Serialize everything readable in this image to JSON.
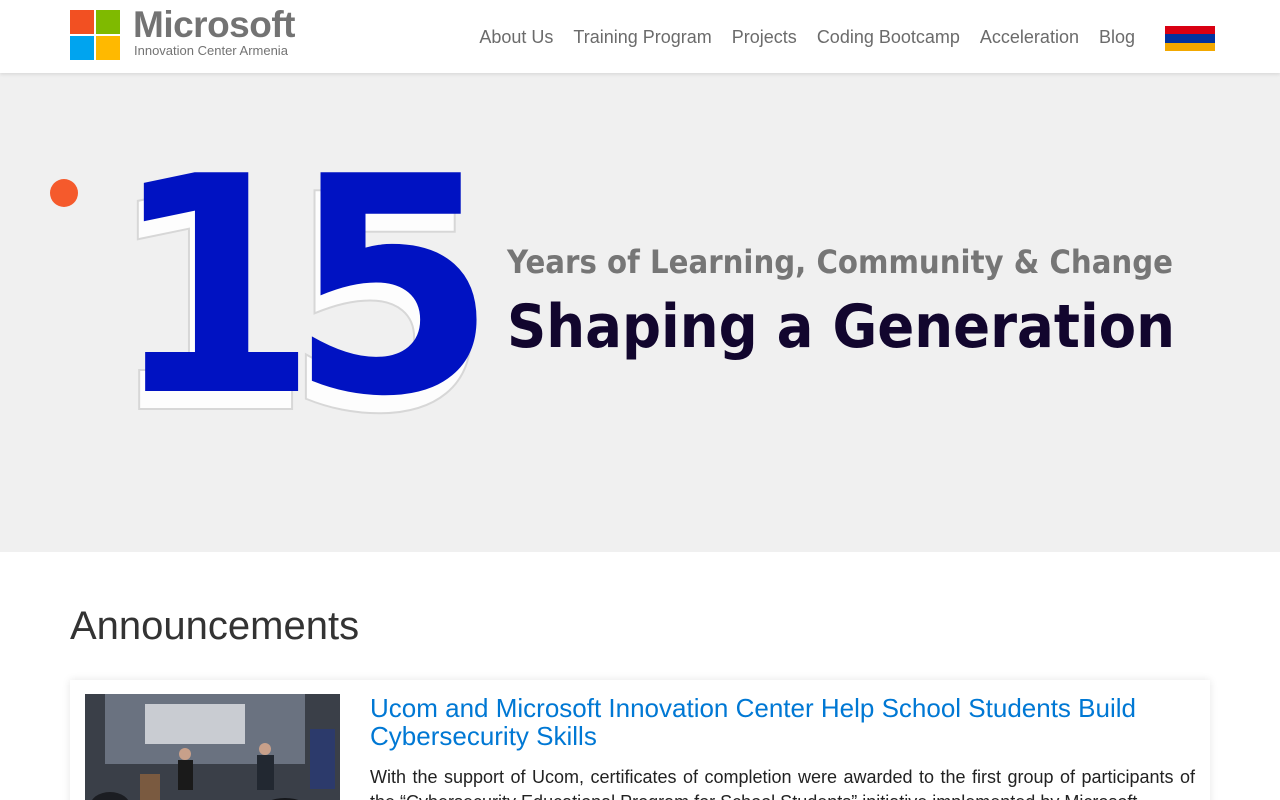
{
  "header": {
    "logo": {
      "brand": "Microsoft",
      "subtitle": "Innovation Center Armenia"
    },
    "nav": [
      {
        "label": "About Us"
      },
      {
        "label": "Training Program"
      },
      {
        "label": "Projects"
      },
      {
        "label": "Coding Bootcamp"
      },
      {
        "label": "Acceleration"
      },
      {
        "label": "Blog"
      }
    ],
    "language_flag": "armenian-flag-icon"
  },
  "hero": {
    "number": "15",
    "tagline": "Years of Learning, Community & Change",
    "headline": "Shaping a Generation",
    "colors": {
      "number": "#0012c2",
      "tagline": "#767676",
      "headline": "#12062e",
      "dot": "#f55a2c",
      "background": "#f0f0f0"
    }
  },
  "announcements": {
    "title": "Announcements",
    "items": [
      {
        "title": "Ucom and Microsoft Innovation Center Help School Students Build Cybersecurity Skills",
        "excerpt": "With the support of Ucom, certificates of completion were awarded to the first group of participants of the “Cybersecurity Educational Program for School Students” initiative implemented by Microsoft",
        "image_alt": "Cybersecurity Fundamentals"
      }
    ]
  },
  "colors": {
    "link": "#0078d4",
    "nav_text": "#6b6b6b"
  }
}
